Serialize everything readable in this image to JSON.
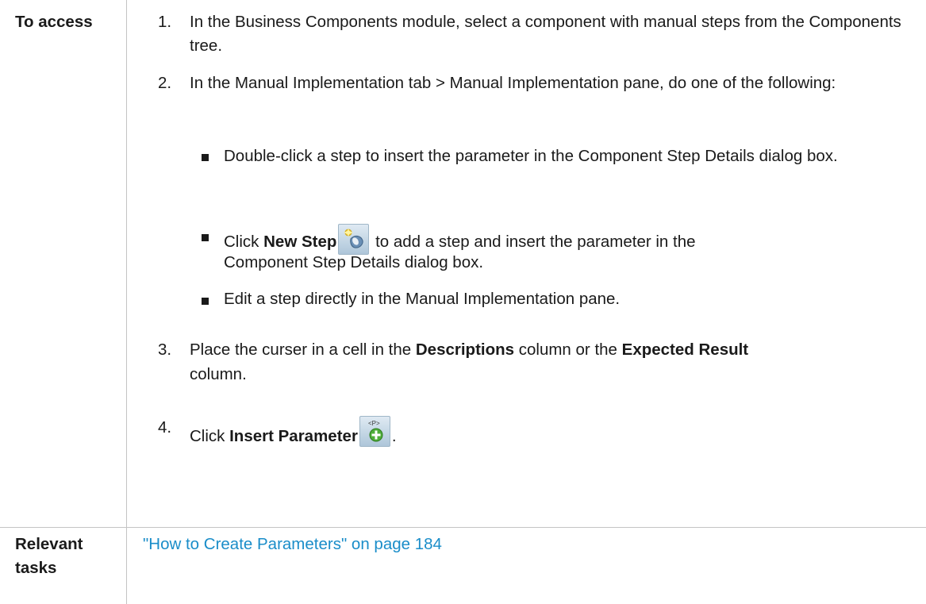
{
  "rows": [
    {
      "label": "To access",
      "steps": [
        {
          "num": "1.",
          "text": "In the Business Components module, select a component with manual steps from the Components tree."
        },
        {
          "num": "2.",
          "text": "In the Manual Implementation tab > Manual Implementation pane, do one of the following:",
          "bullets": {
            "b1": "Double-click a step to insert the parameter in the Component Step Details dialog box.",
            "b2_pre": "Click ",
            "b2_bold": "New Step",
            "b2_post": " to add a step and insert the parameter in the",
            "b2_line2": "Component Step Details dialog box.",
            "b3": "Edit a step directly in the Manual Implementation pane."
          }
        },
        {
          "num": "3.",
          "pre": "Place the curser in a cell in the ",
          "bold1": "Descriptions",
          "mid": " column or the ",
          "bold2": "Expected Result",
          "line2": "column."
        },
        {
          "num": "4.",
          "pre": "Click ",
          "bold": "Insert Parameter",
          "post": "."
        }
      ],
      "icons": [
        "new-step-icon",
        "insert-parameter-icon"
      ]
    },
    {
      "label_line1": "Relevant",
      "label_line2": "tasks",
      "link": "\"How to Create Parameters\" on page 184",
      "link_color": "#1a8dc9"
    }
  ]
}
